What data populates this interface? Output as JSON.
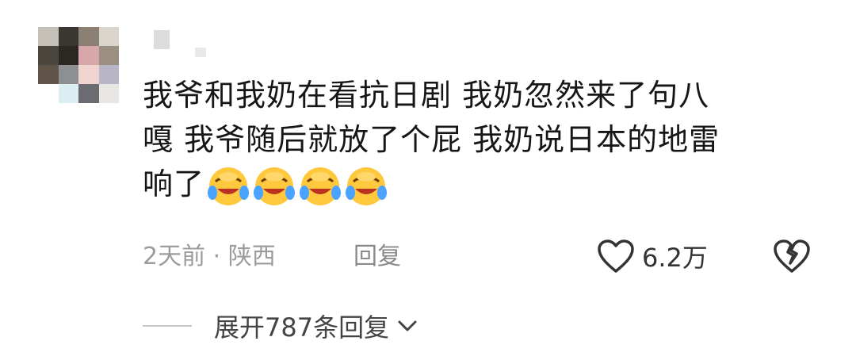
{
  "comment": {
    "text_line1": "我爷和我奶在看抗日剧 我奶忽然来了句八",
    "text_line2": "嘎 我爷随后就放了个屁 我奶说日本的地雷",
    "text_line3": "响了",
    "emojis": [
      "laughing-crying-emoji",
      "laughing-crying-emoji",
      "laughing-crying-emoji",
      "laughing-crying-emoji"
    ]
  },
  "meta": {
    "time_location": "2天前 · 陕西",
    "reply_label": "回复",
    "like_count": "6.2万"
  },
  "replies": {
    "expand_label": "展开787条回复"
  },
  "icons": {
    "like": "heart-outline-icon",
    "dislike": "broken-heart-icon",
    "expand": "chevron-down-icon"
  },
  "colors": {
    "text": "#161616",
    "meta": "#9c9c9c",
    "emoji_yellow": "#ffc83d",
    "emoji_tears": "#4aa3ff"
  }
}
